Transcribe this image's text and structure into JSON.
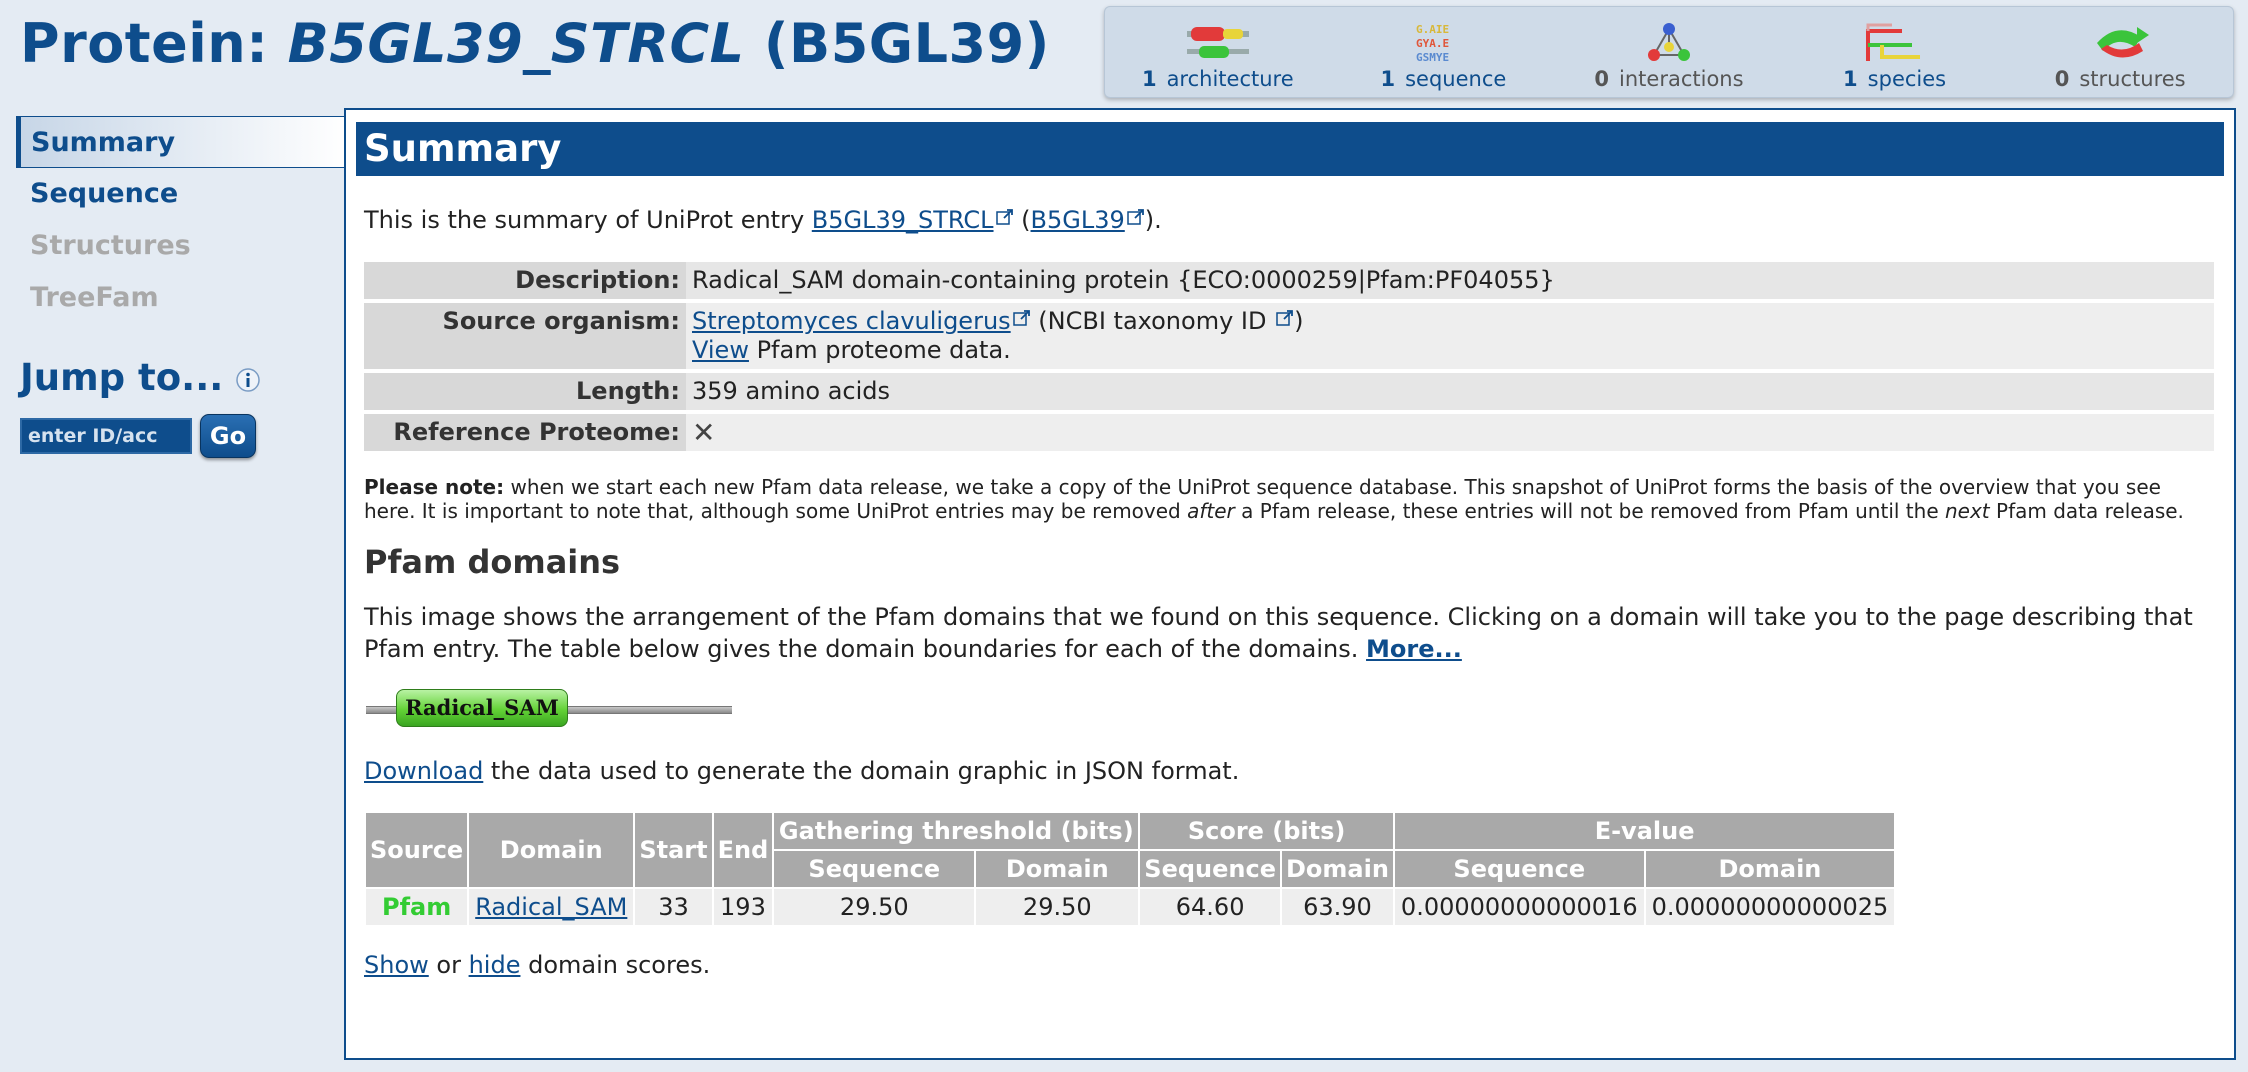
{
  "header": {
    "prefix": "Protein: ",
    "entry_id": "B5GL39_STRCL",
    "accession": "(B5GL39)"
  },
  "icon_bar": [
    {
      "count": "1",
      "label": "architecture",
      "icon": "architecture-icon"
    },
    {
      "count": "1",
      "label": "sequence",
      "icon": "sequence-icon"
    },
    {
      "count": "0",
      "label": "interactions",
      "icon": "interactions-icon"
    },
    {
      "count": "1",
      "label": "species",
      "icon": "species-icon"
    },
    {
      "count": "0",
      "label": "structures",
      "icon": "structures-icon"
    }
  ],
  "sidebar": {
    "items": [
      {
        "label": "Summary",
        "state": "active"
      },
      {
        "label": "Sequence",
        "state": "enabled"
      },
      {
        "label": "Structures",
        "state": "disabled"
      },
      {
        "label": "TreeFam",
        "state": "disabled"
      }
    ],
    "jump_title": "Jump to...",
    "jump_placeholder": "enter ID/acc",
    "go_label": "Go"
  },
  "summary": {
    "heading": "Summary",
    "intro_prefix": "This is the summary of UniProt entry ",
    "intro_entry": "B5GL39_STRCL",
    "intro_acc": "B5GL39",
    "intro_suffix": ").",
    "rows": {
      "description_label": "Description:",
      "description_value": "Radical_SAM domain-containing protein {ECO:0000259|Pfam:PF04055}",
      "organism_label": "Source organism:",
      "organism_link": "Streptomyces clavuligerus",
      "organism_taxid": " (NCBI taxonomy ID ",
      "organism_view": "View",
      "organism_view_suffix": " Pfam proteome data.",
      "length_label": "Length:",
      "length_value": "359 amino acids",
      "refprot_label": "Reference Proteome:",
      "refprot_value": "✕"
    },
    "note_bold": "Please note:",
    "note_a": " when we start each new Pfam data release, we take a copy of the UniProt sequence database. This snapshot of UniProt forms the basis of the overview that you see here. It is important to note that, although some UniProt entries may be removed ",
    "note_after": "after",
    "note_b": " a Pfam release, these entries will not be removed from Pfam until the ",
    "note_next": "next",
    "note_c": " Pfam data release."
  },
  "pfam_domains": {
    "title": "Pfam domains",
    "description": "This image shows the arrangement of the Pfam domains that we found on this sequence. Clicking on a domain will take you to the page describing that Pfam entry. The table below gives the domain boundaries for each of the domains. ",
    "more_link": "More...",
    "graphic_label": "Radical_SAM",
    "download_link": "Download",
    "download_suffix": " the data used to generate the domain graphic in JSON format.",
    "table": {
      "headers": {
        "source": "Source",
        "domain": "Domain",
        "start": "Start",
        "end": "End",
        "gathering": "Gathering threshold (bits)",
        "score": "Score (bits)",
        "evalue": "E-value",
        "sequence": "Sequence",
        "domain_sub": "Domain"
      },
      "row": {
        "source": "Pfam",
        "domain": "Radical_SAM",
        "start": "33",
        "end": "193",
        "gath_seq": "29.50",
        "gath_dom": "29.50",
        "score_seq": "64.60",
        "score_dom": "63.90",
        "eval_seq": "0.00000000000016",
        "eval_dom": "0.00000000000025"
      }
    },
    "show_link": "Show",
    "or_text": " or ",
    "hide_link": "hide",
    "scores_suffix": " domain scores."
  },
  "colors": {
    "brand_blue": "#0e4d8c",
    "pfam_green": "#33cc33",
    "domain_green": "#63d236"
  }
}
